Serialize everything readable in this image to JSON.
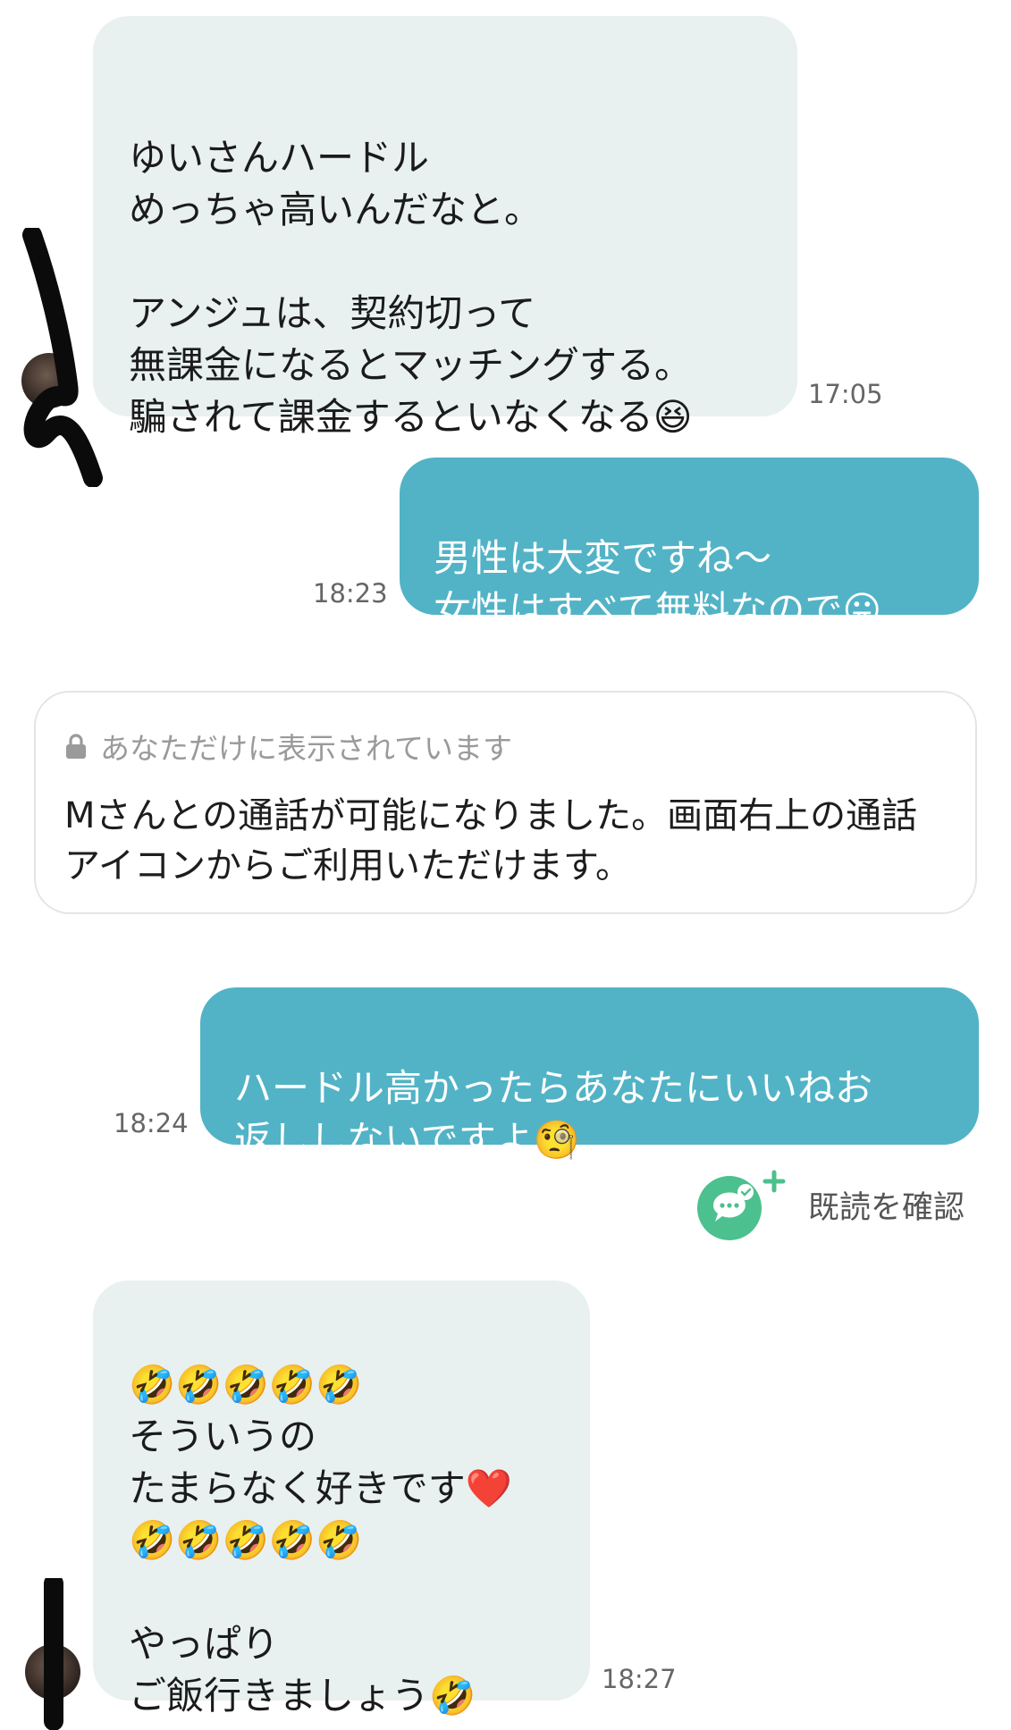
{
  "messages": [
    {
      "id": "m1",
      "direction": "incoming",
      "text": "ゆいさんハードル\nめっちゃ高いんだなと。\n\nアンジュは、契約切って\n無課金になるとマッチングする。\n騙されて課金するといなくなる😆",
      "time": "17:05"
    },
    {
      "id": "m2",
      "direction": "outgoing",
      "text": "男性は大変ですね〜\n女性はすべて無料なので😛",
      "time": "18:23"
    },
    {
      "id": "m3",
      "direction": "outgoing",
      "text": "ハードル高かったらあなたにいいねお\n返ししないですよ🧐",
      "time": "18:24"
    },
    {
      "id": "m4",
      "direction": "incoming",
      "text": "🤣🤣🤣🤣🤣\nそういうの\nたまらなく好きです❤️\n🤣🤣🤣🤣🤣\n\nやっぱり\nご飯行きましょう🤣",
      "time": "18:27"
    }
  ],
  "system_notice": {
    "header": "あなただけに表示されています",
    "body": "Mさんとの通話が可能になりました。画面右上の通話\nアイコンからご利用いただけます。",
    "icon": "lock-icon"
  },
  "read_receipt": {
    "label": "既読を確認",
    "icon": "chat-check-plus-icon",
    "color": "#4cc08e"
  },
  "colors": {
    "outgoing_bubble": "#52b3c6",
    "incoming_bubble": "#e8f1f0"
  }
}
